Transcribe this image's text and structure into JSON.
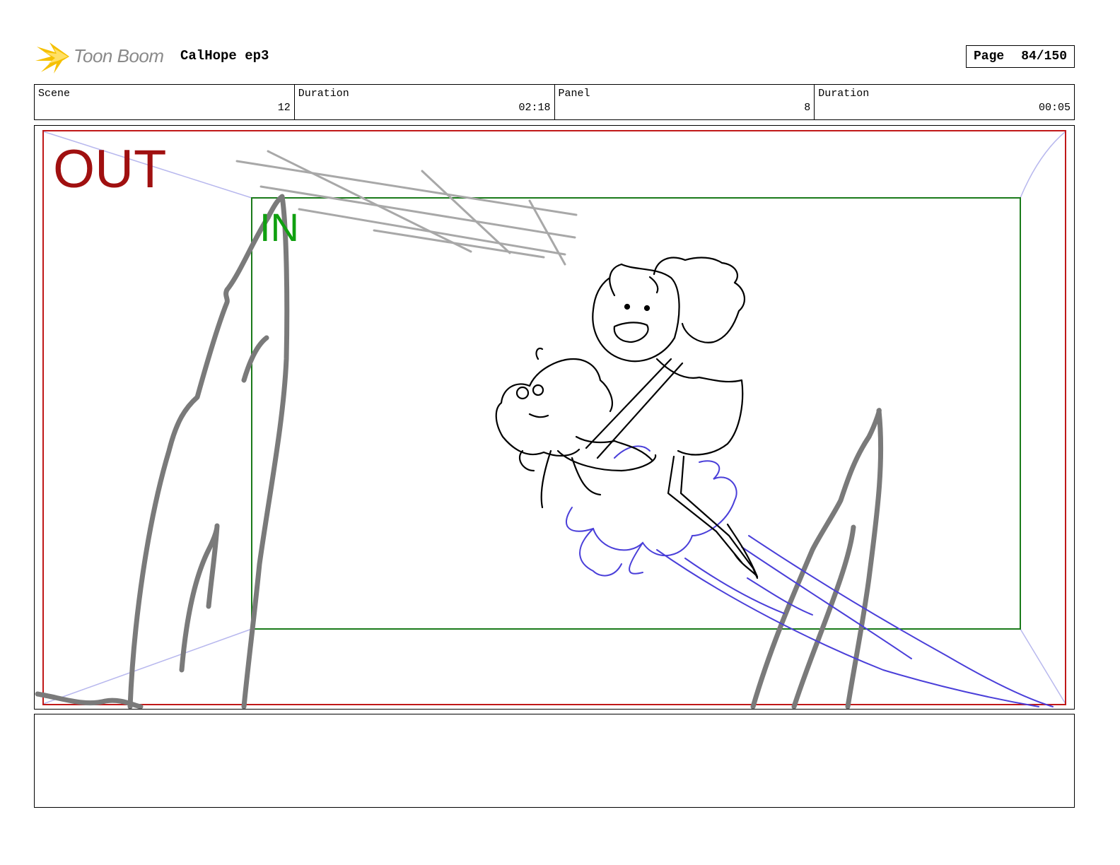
{
  "header": {
    "logo_text": "Toon Boom",
    "logo_icon": "starburst-icon",
    "project_title": "CalHope ep3",
    "page_label": "Page",
    "page_number": "84/150"
  },
  "info": {
    "scene_label": "Scene",
    "scene_value": "12",
    "scene_duration_label": "Duration",
    "scene_duration_value": "02:18",
    "panel_label": "Panel",
    "panel_value": "8",
    "panel_duration_label": "Duration",
    "panel_duration_value": "00:05"
  },
  "panel_frame": {
    "out_label": "OUT",
    "in_label": "IN"
  },
  "colors": {
    "out_frame": "#c01818",
    "in_frame": "#1a7a1a",
    "rock_strokes": "#7a7a7a",
    "speed_lines": "#4a3fd9",
    "character_lines": "#000000"
  },
  "notes": {
    "text": ""
  }
}
